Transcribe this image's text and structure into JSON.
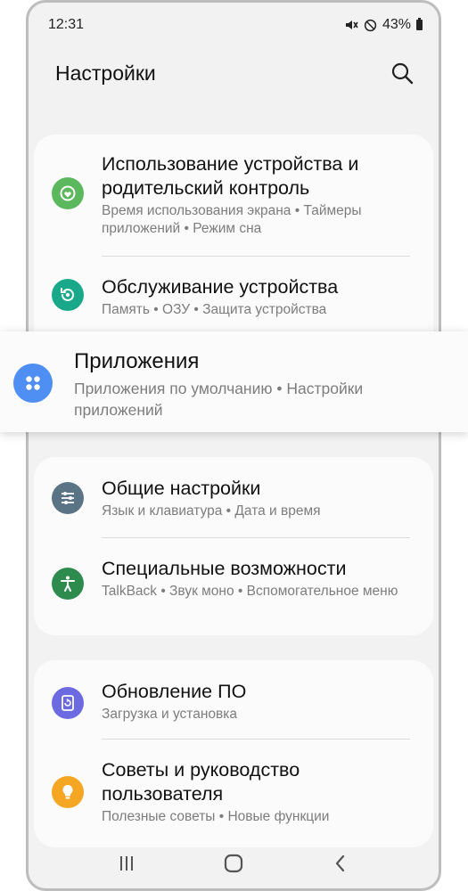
{
  "status": {
    "time": "12:31",
    "battery": "43%"
  },
  "header": {
    "title": "Настройки"
  },
  "cards": [
    {
      "items": [
        {
          "title": "Использование устройства и родительский контроль",
          "subtitle": "Время использования экрана • Таймеры приложений • Режим сна",
          "icon": "digital-wellbeing-icon",
          "color": "#5cb85c"
        },
        {
          "title": "Обслуживание устройства",
          "subtitle": "Память • ОЗУ • Защита устройства",
          "icon": "device-care-icon",
          "color": "#19a98a"
        }
      ]
    },
    {
      "items": [
        {
          "title": "Общие настройки",
          "subtitle": "Язык и клавиатура • Дата и время",
          "icon": "sliders-icon",
          "color": "#5b7485"
        },
        {
          "title": "Специальные возможности",
          "subtitle": "TalkBack • Звук моно • Вспомогательное меню",
          "icon": "accessibility-icon",
          "color": "#2e8b4e"
        }
      ]
    },
    {
      "items": [
        {
          "title": "Обновление ПО",
          "subtitle": "Загрузка и установка",
          "icon": "software-update-icon",
          "color": "#6c6ae0"
        },
        {
          "title": "Советы и руководство пользователя",
          "subtitle": "Полезные советы • Новые функции",
          "icon": "tips-bulb-icon",
          "color": "#f5a623"
        }
      ]
    }
  ],
  "highlight": {
    "title": "Приложения",
    "subtitle": "Приложения по умолчанию • Настройки приложений",
    "icon": "apps-icon",
    "color": "#4f8ef3"
  },
  "navbar": {
    "icons": [
      "recent-apps-icon",
      "home-icon",
      "back-icon"
    ]
  }
}
